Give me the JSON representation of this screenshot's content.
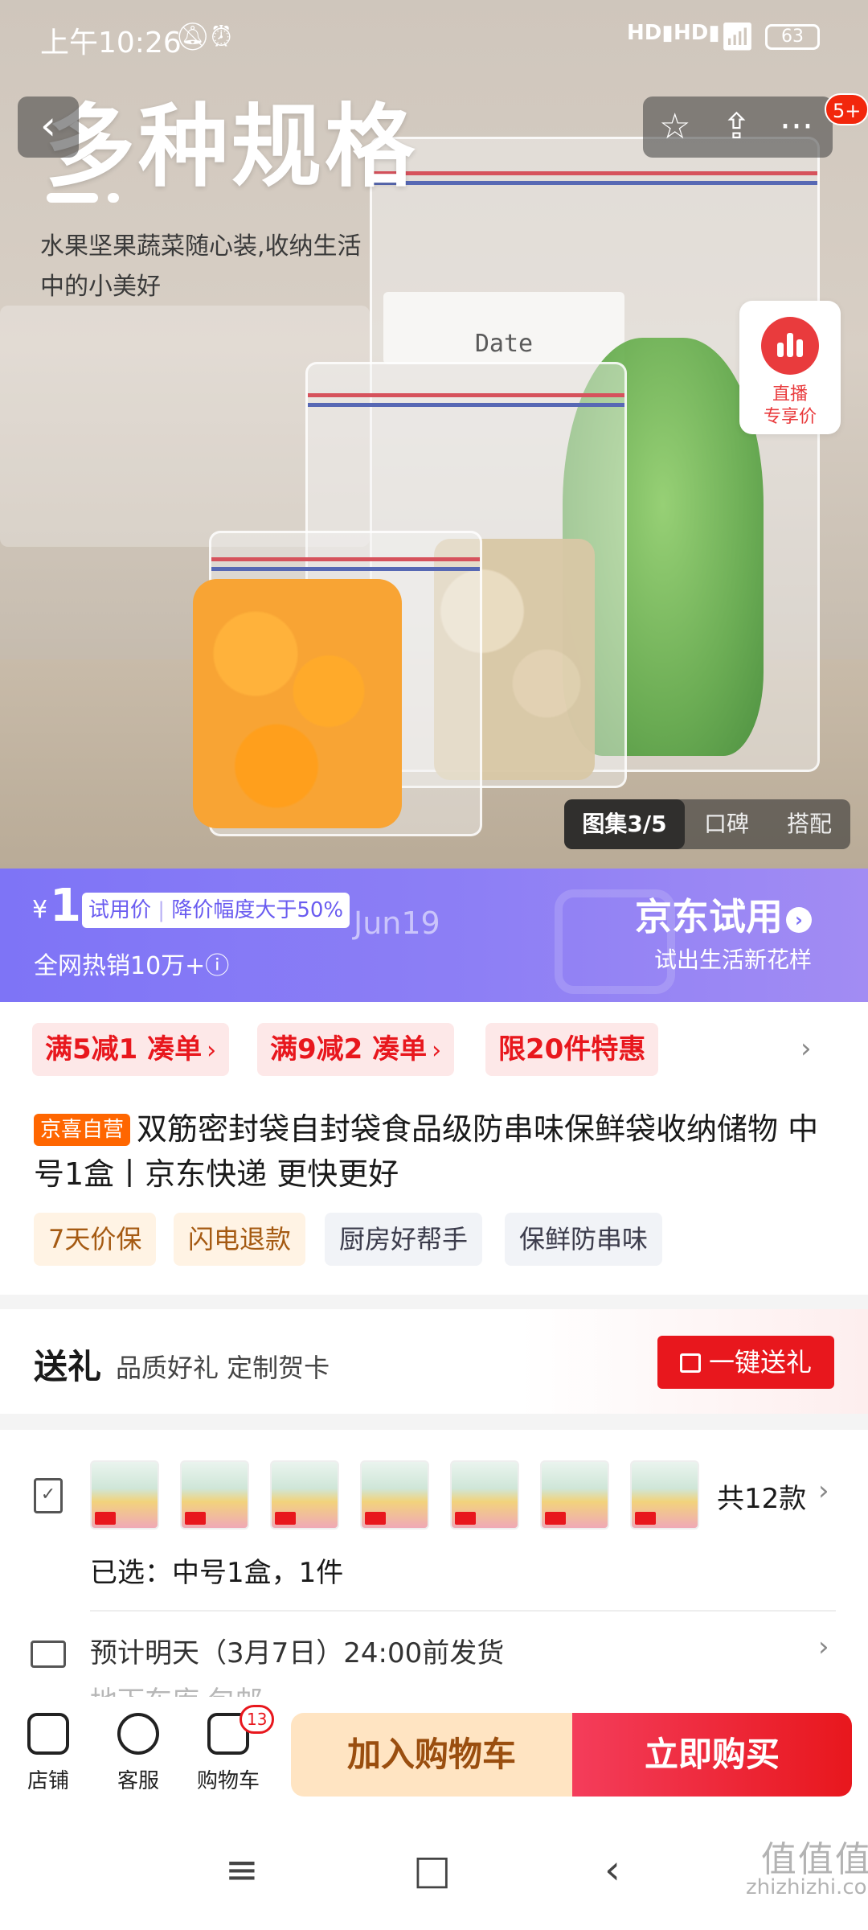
{
  "status_bar": {
    "time": "上午10:26",
    "battery": "63",
    "network_1": "HD",
    "network_2": "HD"
  },
  "top_nav": {
    "back_icon": "‹",
    "favorite_icon": "☆",
    "share_icon": "⇪",
    "more_icon": "···",
    "message_badge": "5+"
  },
  "hero": {
    "title": "多种规格",
    "subtitle": "水果坚果蔬菜随心装,收纳生活中的小美好",
    "bag_label": "Date",
    "live": {
      "line1": "直播",
      "line2": "专享价"
    },
    "gallery_tabs": [
      {
        "label": "图集3/5",
        "active": true
      },
      {
        "label": "口碑",
        "active": false
      },
      {
        "label": "搭配",
        "active": false
      }
    ]
  },
  "trial_banner": {
    "currency": "¥",
    "price": "1",
    "price_label": "试用价",
    "discount_text": "降价幅度大于50%",
    "ghost_text": "Jun19",
    "sales": "全网热销10万+ⓘ",
    "brand": "京东试用",
    "brand_arrow": "›",
    "brand_sub": "试出生活新花样",
    "colors": {
      "start": "#7e74f6",
      "end": "#a28cf3"
    }
  },
  "promotions": [
    {
      "label": "满5减1 凑单",
      "arrow": "›"
    },
    {
      "label": "满9减2 凑单",
      "arrow": "›"
    },
    {
      "label": "限20件特惠",
      "arrow": ""
    }
  ],
  "promotions_more": "›",
  "product": {
    "tag": "京喜自营",
    "title": "双筋密封袋自封袋食品级防串味保鲜袋收纳储物 中号1盒丨京东快递 更快更好",
    "service_tags": [
      {
        "label": "7天价保",
        "style": "orange"
      },
      {
        "label": "闪电退款",
        "style": "orange"
      },
      {
        "label": "厨房好帮手",
        "style": "gray"
      },
      {
        "label": "保鲜防串味",
        "style": "gray"
      }
    ]
  },
  "gift": {
    "title": "送礼",
    "subtitle": "品质好礼 定制贺卡",
    "button": "一键送礼"
  },
  "spec": {
    "thumb_count_shown": 7,
    "total": "共12款",
    "arrow": "›",
    "selected": "已选：中号1盒，1件",
    "shipping": "预计明天（3月7日）24:00前发货",
    "shipping_arrow": "›",
    "partial_text": "地下车库 包邮"
  },
  "bottom_bar": {
    "shop": "店铺",
    "service": "客服",
    "cart": "购物车",
    "cart_count": "13",
    "add_to_cart": "加入购物车",
    "buy_now": "立即购买"
  },
  "system_nav": {
    "menu_icon": "≡",
    "home_icon": "□",
    "back_icon": "‹"
  },
  "watermark": {
    "text": "值值值",
    "domain": "zhizhizhi.com"
  }
}
